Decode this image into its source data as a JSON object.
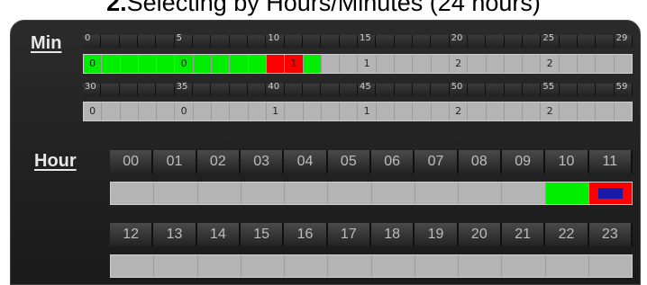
{
  "title": {
    "prefix": "2.",
    "text": "Selecting by Hours/Minutes (24 hours)"
  },
  "min_section": {
    "label": "Min",
    "row1_labels": [
      "0",
      "",
      "",
      "",
      "",
      "5",
      "",
      "",
      "",
      "",
      "10",
      "",
      "",
      "",
      "",
      "15",
      "",
      "",
      "",
      "",
      "20",
      "",
      "",
      "",
      "",
      "25",
      "",
      "",
      "",
      "29"
    ],
    "row2_labels": [
      "30",
      "",
      "",
      "",
      "",
      "35",
      "",
      "",
      "",
      "",
      "40",
      "",
      "",
      "",
      "",
      "45",
      "",
      "",
      "",
      "",
      "50",
      "",
      "",
      "",
      "",
      "55",
      "",
      "",
      "",
      "59"
    ],
    "row1_cells": [
      "green",
      "green",
      "green",
      "green",
      "green",
      "green",
      "green",
      "green",
      "green",
      "green",
      "red",
      "red",
      "green",
      "",
      "",
      "",
      "",
      "",
      "",
      "",
      "",
      "",
      "",
      "",
      "",
      "",
      "",
      "",
      "",
      ""
    ],
    "row1_marks": [
      "0",
      "",
      "",
      "",
      "",
      "0",
      "",
      "",
      "",
      "",
      "",
      "1",
      "",
      "",
      "",
      "1",
      "",
      "",
      "",
      "",
      "2",
      "",
      "",
      "",
      "",
      "2",
      "",
      "",
      "",
      ""
    ],
    "row2_cells": [
      "",
      "",
      "",
      "",
      "",
      "",
      "",
      "",
      "",
      "",
      "",
      "",
      "",
      "",
      "",
      "",
      "",
      "",
      "",
      "",
      "",
      "",
      "",
      "",
      "",
      "",
      "",
      "",
      "",
      ""
    ],
    "row2_marks": [
      "0",
      "",
      "",
      "",
      "",
      "0",
      "",
      "",
      "",
      "",
      "1",
      "",
      "",
      "",
      "",
      "1",
      "",
      "",
      "",
      "",
      "2",
      "",
      "",
      "",
      "",
      "2",
      "",
      "",
      "",
      ""
    ]
  },
  "hour_section": {
    "label": "Hour",
    "row1_heads": [
      "00",
      "01",
      "02",
      "03",
      "04",
      "05",
      "06",
      "07",
      "08",
      "09",
      "10",
      "11"
    ],
    "row2_heads": [
      "12",
      "13",
      "14",
      "15",
      "16",
      "17",
      "18",
      "19",
      "20",
      "21",
      "22",
      "23"
    ],
    "row1_cells": [
      "",
      "",
      "",
      "",
      "",
      "",
      "",
      "",
      "",
      "",
      "green",
      "red-blue"
    ],
    "row2_cells": [
      "",
      "",
      "",
      "",
      "",
      "",
      "",
      "",
      "",
      "",
      "",
      ""
    ]
  },
  "colors": {
    "selected_green": "#00ee00",
    "selected_red": "#ff0000",
    "marker_blue": "#1a1aa8"
  }
}
